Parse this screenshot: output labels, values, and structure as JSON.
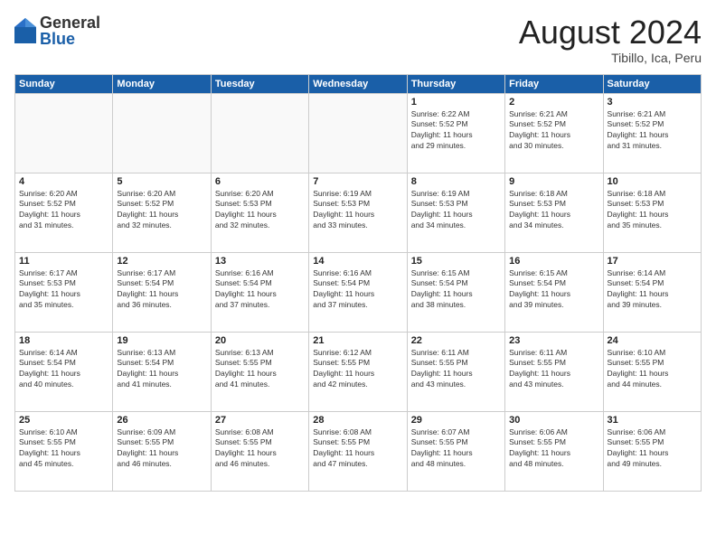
{
  "logo": {
    "general": "General",
    "blue": "Blue"
  },
  "title": "August 2024",
  "location": "Tibillo, Ica, Peru",
  "weekdays": [
    "Sunday",
    "Monday",
    "Tuesday",
    "Wednesday",
    "Thursday",
    "Friday",
    "Saturday"
  ],
  "weeks": [
    [
      {
        "day": "",
        "info": ""
      },
      {
        "day": "",
        "info": ""
      },
      {
        "day": "",
        "info": ""
      },
      {
        "day": "",
        "info": ""
      },
      {
        "day": "1",
        "info": "Sunrise: 6:22 AM\nSunset: 5:52 PM\nDaylight: 11 hours\nand 29 minutes."
      },
      {
        "day": "2",
        "info": "Sunrise: 6:21 AM\nSunset: 5:52 PM\nDaylight: 11 hours\nand 30 minutes."
      },
      {
        "day": "3",
        "info": "Sunrise: 6:21 AM\nSunset: 5:52 PM\nDaylight: 11 hours\nand 31 minutes."
      }
    ],
    [
      {
        "day": "4",
        "info": "Sunrise: 6:20 AM\nSunset: 5:52 PM\nDaylight: 11 hours\nand 31 minutes."
      },
      {
        "day": "5",
        "info": "Sunrise: 6:20 AM\nSunset: 5:52 PM\nDaylight: 11 hours\nand 32 minutes."
      },
      {
        "day": "6",
        "info": "Sunrise: 6:20 AM\nSunset: 5:53 PM\nDaylight: 11 hours\nand 32 minutes."
      },
      {
        "day": "7",
        "info": "Sunrise: 6:19 AM\nSunset: 5:53 PM\nDaylight: 11 hours\nand 33 minutes."
      },
      {
        "day": "8",
        "info": "Sunrise: 6:19 AM\nSunset: 5:53 PM\nDaylight: 11 hours\nand 34 minutes."
      },
      {
        "day": "9",
        "info": "Sunrise: 6:18 AM\nSunset: 5:53 PM\nDaylight: 11 hours\nand 34 minutes."
      },
      {
        "day": "10",
        "info": "Sunrise: 6:18 AM\nSunset: 5:53 PM\nDaylight: 11 hours\nand 35 minutes."
      }
    ],
    [
      {
        "day": "11",
        "info": "Sunrise: 6:17 AM\nSunset: 5:53 PM\nDaylight: 11 hours\nand 35 minutes."
      },
      {
        "day": "12",
        "info": "Sunrise: 6:17 AM\nSunset: 5:54 PM\nDaylight: 11 hours\nand 36 minutes."
      },
      {
        "day": "13",
        "info": "Sunrise: 6:16 AM\nSunset: 5:54 PM\nDaylight: 11 hours\nand 37 minutes."
      },
      {
        "day": "14",
        "info": "Sunrise: 6:16 AM\nSunset: 5:54 PM\nDaylight: 11 hours\nand 37 minutes."
      },
      {
        "day": "15",
        "info": "Sunrise: 6:15 AM\nSunset: 5:54 PM\nDaylight: 11 hours\nand 38 minutes."
      },
      {
        "day": "16",
        "info": "Sunrise: 6:15 AM\nSunset: 5:54 PM\nDaylight: 11 hours\nand 39 minutes."
      },
      {
        "day": "17",
        "info": "Sunrise: 6:14 AM\nSunset: 5:54 PM\nDaylight: 11 hours\nand 39 minutes."
      }
    ],
    [
      {
        "day": "18",
        "info": "Sunrise: 6:14 AM\nSunset: 5:54 PM\nDaylight: 11 hours\nand 40 minutes."
      },
      {
        "day": "19",
        "info": "Sunrise: 6:13 AM\nSunset: 5:54 PM\nDaylight: 11 hours\nand 41 minutes."
      },
      {
        "day": "20",
        "info": "Sunrise: 6:13 AM\nSunset: 5:55 PM\nDaylight: 11 hours\nand 41 minutes."
      },
      {
        "day": "21",
        "info": "Sunrise: 6:12 AM\nSunset: 5:55 PM\nDaylight: 11 hours\nand 42 minutes."
      },
      {
        "day": "22",
        "info": "Sunrise: 6:11 AM\nSunset: 5:55 PM\nDaylight: 11 hours\nand 43 minutes."
      },
      {
        "day": "23",
        "info": "Sunrise: 6:11 AM\nSunset: 5:55 PM\nDaylight: 11 hours\nand 43 minutes."
      },
      {
        "day": "24",
        "info": "Sunrise: 6:10 AM\nSunset: 5:55 PM\nDaylight: 11 hours\nand 44 minutes."
      }
    ],
    [
      {
        "day": "25",
        "info": "Sunrise: 6:10 AM\nSunset: 5:55 PM\nDaylight: 11 hours\nand 45 minutes."
      },
      {
        "day": "26",
        "info": "Sunrise: 6:09 AM\nSunset: 5:55 PM\nDaylight: 11 hours\nand 46 minutes."
      },
      {
        "day": "27",
        "info": "Sunrise: 6:08 AM\nSunset: 5:55 PM\nDaylight: 11 hours\nand 46 minutes."
      },
      {
        "day": "28",
        "info": "Sunrise: 6:08 AM\nSunset: 5:55 PM\nDaylight: 11 hours\nand 47 minutes."
      },
      {
        "day": "29",
        "info": "Sunrise: 6:07 AM\nSunset: 5:55 PM\nDaylight: 11 hours\nand 48 minutes."
      },
      {
        "day": "30",
        "info": "Sunrise: 6:06 AM\nSunset: 5:55 PM\nDaylight: 11 hours\nand 48 minutes."
      },
      {
        "day": "31",
        "info": "Sunrise: 6:06 AM\nSunset: 5:55 PM\nDaylight: 11 hours\nand 49 minutes."
      }
    ]
  ]
}
